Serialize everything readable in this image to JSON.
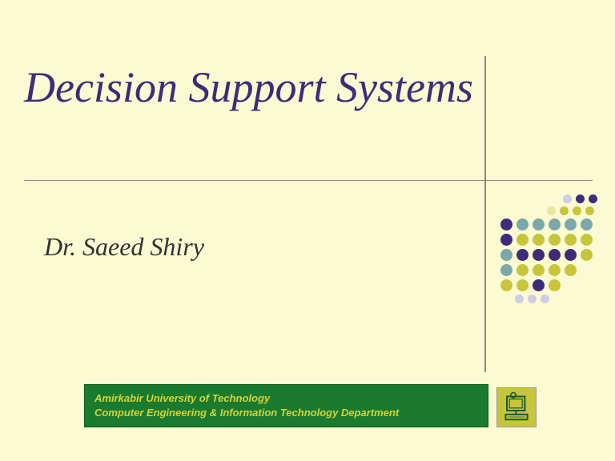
{
  "title": "Decision Support Systems",
  "author": "Dr. Saeed Shiry",
  "footer": {
    "line1": "Amirkabir University of Technology",
    "line2": "Computer Engineering & Information Technology Department"
  },
  "colors": {
    "title_color": "#3d2c7a",
    "footer_bg": "#1a7a2e",
    "footer_text": "#d4d43a",
    "icon_bg": "#c6c53b"
  }
}
